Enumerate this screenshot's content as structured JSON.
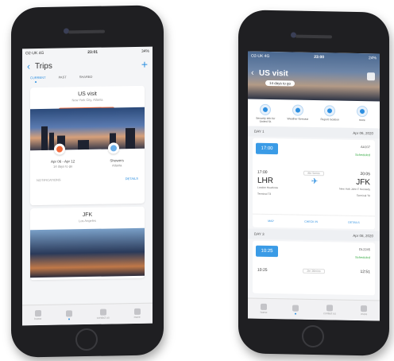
{
  "left_screen": {
    "status": {
      "carrier": "O2-UK 4G",
      "time": "23:01",
      "battery": "34%"
    },
    "header": {
      "title": "Trips",
      "back_icon": "chevron-left-icon",
      "add_icon": "plus-icon"
    },
    "tabs": [
      {
        "label": "CURRENT",
        "active": true
      },
      {
        "label": "PAST",
        "active": false
      },
      {
        "label": "SHARED",
        "active": false
      }
    ],
    "trip_cards": [
      {
        "title": "US visit",
        "subtitle": "New York City, Atlanta",
        "shared_badge": "Shared with Felix Kilroff",
        "dates": "Apr 06 - Apr 12",
        "countdown": "14 days to go",
        "weather": "Showers",
        "weather_location": "Atlanta",
        "notifications_label": "NOTIFICATIONS",
        "details_label": "DETAILS"
      },
      {
        "title": "JFK",
        "subtitle": "Los Angeles"
      }
    ],
    "tabbar": [
      {
        "label": "home"
      },
      {
        "label": ""
      },
      {
        "label": "contact us"
      },
      {
        "label": "more"
      }
    ]
  },
  "right_screen": {
    "status": {
      "carrier": "O2-UK 4G",
      "time": "23:00",
      "battery": "24%"
    },
    "hero": {
      "title": "US visit",
      "pill": "14 days to go"
    },
    "actions": [
      {
        "label": "Security info for United St.",
        "icon": "shield-icon"
      },
      {
        "label": "Weather forecast",
        "icon": "cloud-icon"
      },
      {
        "label": "Report location",
        "icon": "pin-icon"
      },
      {
        "label": "more",
        "icon": "more-icon"
      }
    ],
    "days": [
      {
        "label": "DAY 1",
        "date": "Apr 06, 2020",
        "flight": {
          "dep_time_box": "17:00",
          "number": "AA107",
          "status": "Scheduled",
          "dep_time": "17:00",
          "arr_time": "20:05",
          "duration": "8hr 5mins",
          "from_code": "LHR",
          "to_code": "JFK",
          "from_airport": "London Heathrow",
          "to_airport": "New York John F Kennedy",
          "from_terminal": "Terminal T3",
          "to_terminal": "Terminal T8",
          "map_label": "MAP",
          "checkin_label": "CHECK IN",
          "details_label": "DETAILS"
        }
      },
      {
        "label": "DAY 3",
        "date": "Apr 08, 2020",
        "flight": {
          "dep_time_box": "10:25",
          "number": "DL2245",
          "status": "Scheduled",
          "dep_time": "10:25",
          "arr_time": "12:51",
          "duration": "2hr 26mins"
        }
      }
    ],
    "tabbar": [
      {
        "label": "home"
      },
      {
        "label": ""
      },
      {
        "label": "contact us"
      },
      {
        "label": "more"
      }
    ]
  }
}
